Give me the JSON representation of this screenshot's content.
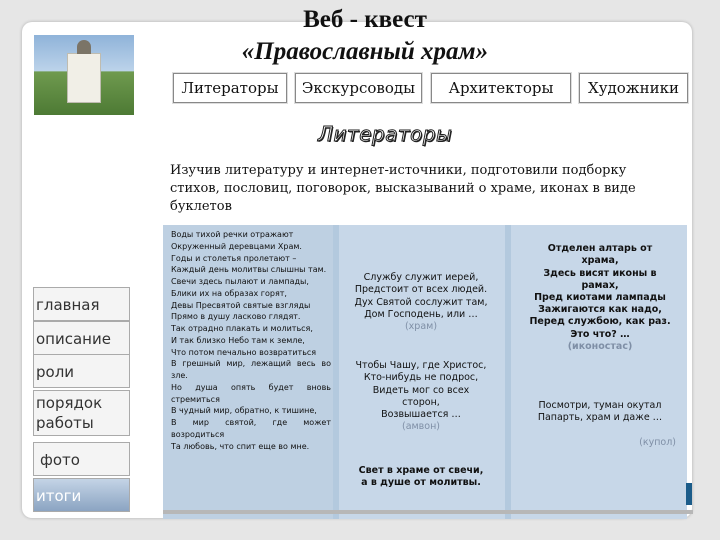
{
  "title": {
    "line1": "Веб - квест",
    "line2": "«Православный храм»"
  },
  "tabs": [
    "Литераторы",
    "Экскурсоводы",
    "Архитекторы",
    "Художники"
  ],
  "section_title": "Литераторы",
  "intro": "Изучив литературу и интернет-источники, подготовили подборку стихов, пословиц, поговорок, высказываний о храме, иконах в виде буклетов",
  "sidebar": [
    "главная",
    "описание",
    "роли",
    "порядок работы",
    "фото",
    "итоги"
  ],
  "poem": "Воды тихой речки отражают\nОкруженный деревцами Храм.\nГоды и столетья пролетают –\nКаждый день молитвы слышны там.\nСвечи здесь пылают и лампады,\nБлики их на образах горят,\nДевы Пресвятой святые взгляды\nПрямо в душу ласково глядят.\nТак отрадно плакать и молиться,\nИ так близко Небо там к земле,\nЧто потом печально возвратиться\nВ грешный мир, лежащий весь во зле.\nНо душа опять будет вновь стремиться\nВ чудный мир, обратно, к тишине,\nВ мир святой, где может возродиться\nТа любовь, что спит еще во мне.",
  "riddle1": {
    "text": "Службу служит иерей,\nПредстоит от всех людей.\nДух Святой сослужит там,\nДом Господень, или …",
    "answer": "(храм)"
  },
  "riddle2": {
    "text": "Чтобы Чашу, где Христос,\nКто-нибудь не подрос,\nВидеть мог со всех\nсторон,\nВозвышается …",
    "answer": "(амвон)"
  },
  "proverb": "Свет в храме от свечи,\nа в душе от молитвы.",
  "riddle3": {
    "text": "Отделен алтарь от\nхрама,\nЗдесь висят иконы в\nрамах,\nПред киотами лампады\nЗажигаются как надо,\nПеред службою, как раз.\nЭто что? …",
    "answer": "(иконостас)"
  },
  "riddle4": {
    "text": "Посмотри, туман окутал\nПапарть, храм и даже …",
    "answer": "(купол)"
  }
}
